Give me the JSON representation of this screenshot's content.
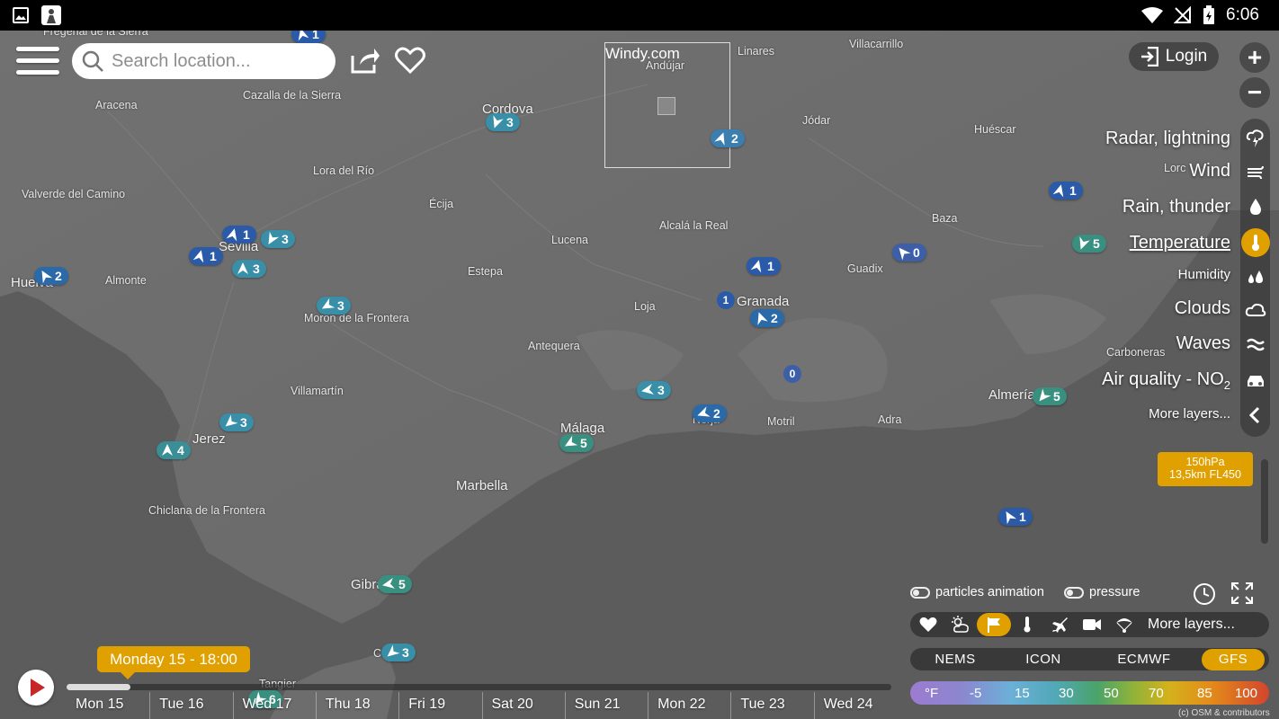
{
  "status_bar": {
    "time": "6:06",
    "icons": [
      "gallery-icon",
      "app-notification-icon",
      "wifi-icon",
      "no-signal-icon",
      "battery-charging-icon"
    ]
  },
  "top_bar": {
    "search_placeholder": "Search location...",
    "login_label": "Login",
    "zoom_in": "+",
    "zoom_out": "−"
  },
  "webcam": {
    "title": "Windy.com"
  },
  "places": [
    {
      "name": "Fregenal de la Sierra",
      "big": false
    },
    {
      "name": "Aracena",
      "big": false
    },
    {
      "name": "Cazalla de la Sierra",
      "big": false
    },
    {
      "name": "Cordova",
      "big": true
    },
    {
      "name": "Andújar",
      "big": false
    },
    {
      "name": "Linares",
      "big": false
    },
    {
      "name": "Villacarrillo",
      "big": false
    },
    {
      "name": "Jódar",
      "big": false
    },
    {
      "name": "Huéscar",
      "big": false
    },
    {
      "name": "Lora del Río",
      "big": false
    },
    {
      "name": "Valverde del Camino",
      "big": false
    },
    {
      "name": "Écija",
      "big": false
    },
    {
      "name": "Lorc",
      "big": false
    },
    {
      "name": "Alcalá la Real",
      "big": false
    },
    {
      "name": "Baza",
      "big": false
    },
    {
      "name": "Lucena",
      "big": false
    },
    {
      "name": "Sevilla",
      "big": true
    },
    {
      "name": "Huelva",
      "big": true
    },
    {
      "name": "Almonte",
      "big": false
    },
    {
      "name": "Estepa",
      "big": false
    },
    {
      "name": "Guadix",
      "big": false
    },
    {
      "name": "Granada",
      "big": true
    },
    {
      "name": "Moron de la Frontera",
      "big": false
    },
    {
      "name": "Loja",
      "big": false
    },
    {
      "name": "Antequera",
      "big": false
    },
    {
      "name": "Carboneras",
      "big": false
    },
    {
      "name": "Villamartín",
      "big": false
    },
    {
      "name": "Almería",
      "big": true
    },
    {
      "name": "Málaga",
      "big": true
    },
    {
      "name": "Motril",
      "big": false
    },
    {
      "name": "Adra",
      "big": false
    },
    {
      "name": "Nerja",
      "big": false
    },
    {
      "name": "Jerez",
      "big": true
    },
    {
      "name": "Marbella",
      "big": true
    },
    {
      "name": "Chiclana de la Frontera",
      "big": false
    },
    {
      "name": "Gibraltar",
      "big": true
    },
    {
      "name": "Tangier",
      "big": false
    },
    {
      "name": "Ceuta",
      "big": false
    }
  ],
  "wind_markers": [
    {
      "value": "1",
      "color": "#2b5aa8",
      "dir": -15
    },
    {
      "value": "3",
      "color": "#3a8fa8",
      "dir": 200
    },
    {
      "value": "2",
      "color": "#3a7fb0",
      "dir": 20
    },
    {
      "value": "1",
      "color": "#2b5aa8",
      "dir": 15
    },
    {
      "value": "5",
      "color": "#3a9080",
      "dir": 200
    },
    {
      "value": "0",
      "color": "#3d5fa8",
      "dir": -40
    },
    {
      "value": "1",
      "color": "#2b5aa8",
      "dir": 15
    },
    {
      "value": "3",
      "color": "#3a8fa8",
      "dir": 210
    },
    {
      "value": "1",
      "color": "#2b5aa8",
      "dir": 15
    },
    {
      "value": "2",
      "color": "#2b6aa8",
      "dir": -30
    },
    {
      "value": "3",
      "color": "#3a8fa8",
      "dir": 0
    },
    {
      "value": "1",
      "color": "#2b5aa8",
      "dir": 15
    },
    {
      "value": "3",
      "color": "#3a8fa8",
      "dir": 240
    },
    {
      "value": "2",
      "color": "#2b6aa8",
      "dir": -20
    },
    {
      "value": "5",
      "color": "#3a9080",
      "dir": 220
    },
    {
      "value": "4",
      "color": "#3a8f96",
      "dir": 0
    },
    {
      "value": "3",
      "color": "#3a8fa8",
      "dir": 260
    },
    {
      "value": "2",
      "color": "#2b6aa8",
      "dir": 250
    },
    {
      "value": "3",
      "color": "#3a8fa8",
      "dir": 230
    },
    {
      "value": "5",
      "color": "#3a9080",
      "dir": 240
    },
    {
      "value": "1",
      "color": "#2b5aa8",
      "dir": -30
    },
    {
      "value": "5",
      "color": "#3a9080",
      "dir": 260
    },
    {
      "value": "3",
      "color": "#3a8fa8",
      "dir": 230
    },
    {
      "value": "6",
      "color": "#3a9080",
      "dir": 220
    }
  ],
  "dot_markers": [
    {
      "value": "1",
      "color": "#2b5aa8"
    },
    {
      "value": "0",
      "color": "#3d5fa8"
    }
  ],
  "layers": [
    {
      "label": "Radar, lightning",
      "icon": "lightning-cloud-icon",
      "active": false,
      "small": false
    },
    {
      "label": "Wind",
      "icon": "wind-icon",
      "active": false,
      "small": false
    },
    {
      "label": "Rain, thunder",
      "icon": "raindrop-icon",
      "active": false,
      "small": false
    },
    {
      "label": "Temperature",
      "icon": "thermometer-icon",
      "active": true,
      "small": false
    },
    {
      "label": "Humidity",
      "icon": "humidity-icon",
      "active": false,
      "small": true
    },
    {
      "label": "Clouds",
      "icon": "cloud-icon",
      "active": false,
      "small": false
    },
    {
      "label": "Waves",
      "icon": "waves-icon",
      "active": false,
      "small": false
    },
    {
      "label_main": "Air quality - NO",
      "label_sub": "2",
      "icon": "car-icon",
      "active": false,
      "small": false
    },
    {
      "label": "More layers...",
      "icon": "chevron-left-icon",
      "active": false,
      "small": true
    }
  ],
  "altitude": {
    "pressure": "150hPa",
    "height": "13,5km FL450"
  },
  "toggles": {
    "particles": "particles animation",
    "pressure": "pressure"
  },
  "overlays": {
    "icons": [
      "heart-icon",
      "sun-cloud-icon",
      "flag-icon",
      "thermometer-icon",
      "airplane-icon",
      "camera-icon",
      "paraglider-icon"
    ],
    "active_index": 2,
    "more_label": "More layers..."
  },
  "models": [
    {
      "label": "NEMS",
      "active": false
    },
    {
      "label": "ICON",
      "active": false
    },
    {
      "label": "ECMWF",
      "active": false
    },
    {
      "label": "GFS",
      "active": true
    }
  ],
  "color_scale": {
    "unit": "°F",
    "values": [
      "-5",
      "15",
      "30",
      "50",
      "70",
      "85",
      "100"
    ]
  },
  "timeline": {
    "current_time": "Monday 15 - 18:00",
    "progress": 0.077,
    "days": [
      "Mon 15",
      "Tue 16",
      "Wed 17",
      "Thu 18",
      "Fri 19",
      "Sat 20",
      "Sun 21",
      "Mon 22",
      "Tue 23",
      "Wed 24"
    ]
  },
  "copyright": "(c) OSM & contributors"
}
